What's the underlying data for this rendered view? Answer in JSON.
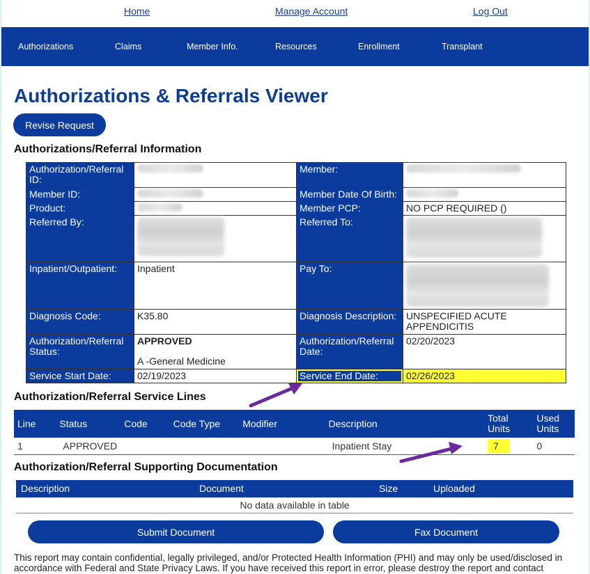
{
  "top_links": {
    "home": "Home",
    "manage_account": "Manage Account",
    "log_out": "Log Out"
  },
  "nav": [
    "Authorizations",
    "Claims",
    "Member Info.",
    "Resources",
    "Enrollment",
    "Transplant"
  ],
  "page_title": "Authorizations & Referrals Viewer",
  "revise_button": "Revise Request",
  "info_section": {
    "title": "Authorizations/Referral Information",
    "labels": {
      "auth_id": "Authorization/Referral ID:",
      "member": "Member:",
      "member_id": "Member ID:",
      "member_dob": "Member Date Of Birth:",
      "product": "Product:",
      "member_pcp": "Member PCP:",
      "referred_by": "Referred By:",
      "referred_to": "Referred To:",
      "in_out": "Inpatient/Outpatient:",
      "pay_to": "Pay To:",
      "diag_code": "Diagnosis Code:",
      "diag_desc": "Diagnosis Description:",
      "status": "Authorization/Referral Status:",
      "auth_date": "Authorization/Referral Date:",
      "start_date": "Service Start Date:",
      "end_date": "Service End Date:"
    },
    "values": {
      "member_pcp": "NO PCP REQUIRED ()",
      "in_out": "Inpatient",
      "diag_code": "K35.80",
      "diag_desc": "UNSPECIFIED ACUTE APPENDICITIS",
      "status": "APPROVED",
      "status_detail": "A -General Medicine",
      "auth_date": "02/20/2023",
      "start_date": "02/19/2023",
      "end_date": "02/26/2023"
    }
  },
  "service_lines": {
    "title": "Authorization/Referral Service Lines",
    "headers": {
      "line": "Line",
      "status": "Status",
      "code": "Code",
      "code_type": "Code Type",
      "modifier": "Modifier",
      "description": "Description",
      "total_units": "Total Units",
      "used_units": "Used Units"
    },
    "rows": [
      {
        "line": "1",
        "status": "APPROVED",
        "code": "",
        "code_type": "",
        "modifier": "",
        "description": "Inpatient Stay",
        "total_units": "7",
        "used_units": "0"
      }
    ]
  },
  "documentation": {
    "title": "Authorization/Referral Supporting Documentation",
    "headers": {
      "description": "Description",
      "document": "Document",
      "size": "Size",
      "uploaded": "Uploaded"
    },
    "empty_message": "No data available in table",
    "submit_button": "Submit Document",
    "fax_button": "Fax Document"
  },
  "disclaimer": "This report may contain confidential, legally privileged, and/or Protected Health Information (PHI) and may only be used/disclosed in accordance with Federal and State Privacy Laws. If you have received this report in error, please destroy the report and contact",
  "colors": {
    "brand_blue": "#0b3b9c",
    "title_blue": "#0e3d94",
    "highlight": "#ffff33",
    "annotation_arrow": "#6a2a9e"
  }
}
